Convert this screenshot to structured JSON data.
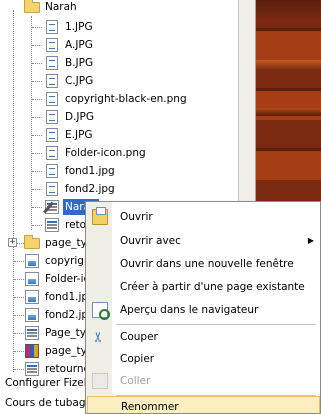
{
  "tree": {
    "root_folder": "Narah",
    "files": [
      "1.JPG",
      "A.JPG",
      "B.JPG",
      "C.JPG",
      "copyright-black-en.png",
      "D.JPG",
      "E.JPG",
      "Folder-icon.png",
      "fond1.jpg",
      "fond2.jpg"
    ],
    "selected_file": "Narah.html",
    "selected_file_visible": "Narah",
    "after_selected": "retour",
    "sibling_folder": "page_ty",
    "parent_items": [
      {
        "label": "copyrigh",
        "icon": "image-icon"
      },
      {
        "label": "Folder-ic",
        "icon": "image-icon"
      },
      {
        "label": "fond1.jp",
        "icon": "image-icon"
      },
      {
        "label": "fond2.jp",
        "icon": "image-icon"
      },
      {
        "label": "Page_ty",
        "icon": "html-icon"
      },
      {
        "label": "page_ty",
        "icon": "rar-icon"
      },
      {
        "label": "retourne",
        "icon": "html-icon"
      }
    ],
    "bottom_items": [
      "Configurer Fizelle",
      "Cours de tubage"
    ]
  },
  "context_menu": {
    "items": [
      {
        "label": "Ouvrir",
        "icon": "open-icon",
        "disabled": false,
        "submenu": false
      },
      {
        "label": "Ouvrir avec",
        "icon": "",
        "disabled": false,
        "submenu": true
      },
      {
        "label": "Ouvrir dans une nouvelle fenêtre",
        "icon": "",
        "disabled": false,
        "submenu": false
      },
      {
        "label": "Créer à partir d'une page existante",
        "icon": "",
        "disabled": false,
        "submenu": false
      },
      {
        "label": "Aperçu dans le navigateur",
        "icon": "preview-icon",
        "disabled": false,
        "submenu": false
      },
      {
        "label": "Couper",
        "icon": "cut-icon",
        "disabled": false,
        "submenu": false
      },
      {
        "label": "Copier",
        "icon": "",
        "disabled": false,
        "submenu": false
      },
      {
        "label": "Coller",
        "icon": "paste-icon",
        "disabled": true,
        "submenu": false
      },
      {
        "label": "Renommer",
        "icon": "",
        "disabled": false,
        "submenu": false,
        "highlighted": true
      }
    ],
    "submenu_arrow": "▶"
  },
  "colors": {
    "selection": "#316ac5",
    "menu_highlight": "#fbeec1",
    "menu_gutter": "#f0efe7"
  }
}
